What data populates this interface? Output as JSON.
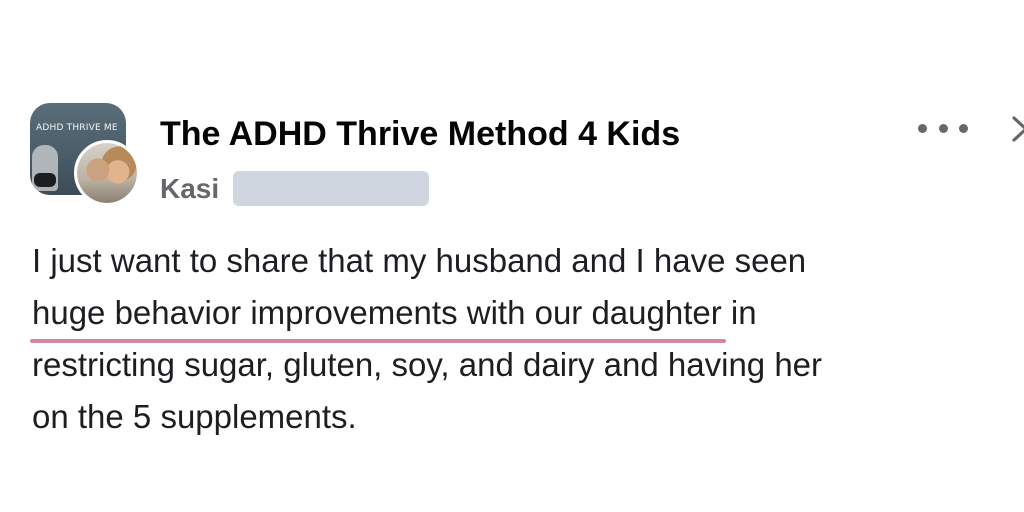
{
  "post": {
    "group_name": "The ADHD Thrive Method 4 Kids",
    "group_avatar_text": "ADHD THRIVE ME",
    "author_name": "Kasi",
    "text": {
      "line1": "I just want to share that my husband and I have seen",
      "line2_highlight": "huge behavior improvements with our daughter",
      "line2_rest": " in",
      "line3": "restricting sugar, gluten, soy, and dairy and having her",
      "line4": "on the 5 supplements."
    },
    "highlight_color": "#d7869f",
    "icons": {
      "more": "more-horizontal-icon",
      "close": "chevron-right-icon"
    }
  }
}
